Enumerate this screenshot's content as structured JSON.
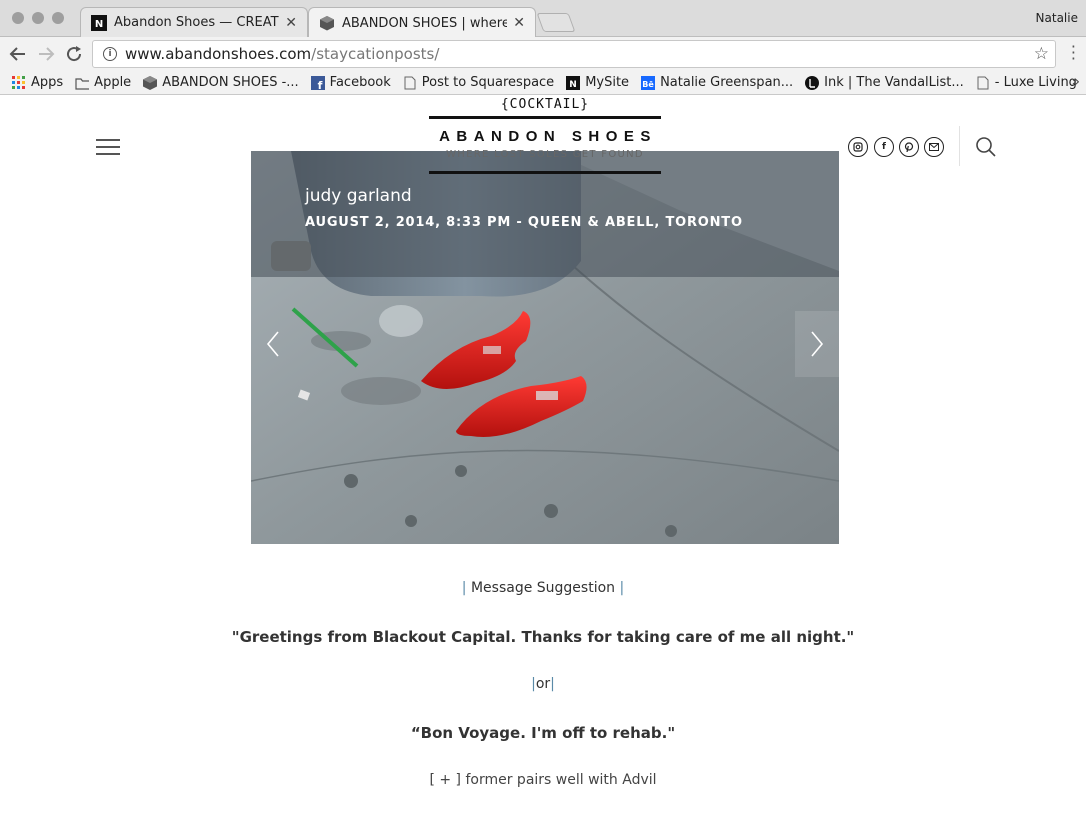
{
  "browser": {
    "tabs": [
      {
        "title": "Abandon Shoes — CREATIVE A",
        "favicon": "n-logo-icon",
        "active": false
      },
      {
        "title": "ABANDON SHOES | where lost",
        "favicon": "cube-icon",
        "active": true
      }
    ],
    "profile_name": "Natalie",
    "url_host": "www.abandonshoes.com",
    "url_path": "/staycationposts/",
    "bookmarks": [
      {
        "label": "Apps",
        "icon": "apps-grid-icon"
      },
      {
        "label": "Apple",
        "icon": "folder-icon"
      },
      {
        "label": "ABANDON SHOES -...",
        "icon": "cube-icon"
      },
      {
        "label": "Facebook",
        "icon": "facebook-icon"
      },
      {
        "label": "Post to Squarespace",
        "icon": "page-icon"
      },
      {
        "label": "MySite",
        "icon": "n-logo-icon"
      },
      {
        "label": "Natalie Greenspan...",
        "icon": "behance-icon"
      },
      {
        "label": "Ink | The VandalList...",
        "icon": "ink-icon"
      },
      {
        "label": "- Luxe Living",
        "icon": "page-icon"
      }
    ]
  },
  "site": {
    "cocktail": "{COCKTAIL}",
    "logo_title": "ABANDON SHOES",
    "logo_tagline": "WHERE LOST SOLES GET FOUND",
    "social_icons": [
      "instagram-icon",
      "facebook-icon",
      "pinterest-icon",
      "email-icon"
    ]
  },
  "slide": {
    "title": "judy garland",
    "meta": "AUGUST 2, 2014, 8:33 PM - QUEEN & ABELL, TORONTO"
  },
  "content": {
    "message_suggestion": "Message Suggestion",
    "quote_one": "\"Greetings from Blackout Capital. Thanks for taking care of me all night.\"",
    "or_text": "or",
    "quote_two": "“Bon Voyage. I'm off to rehab.\"",
    "footer_note": "[ + ] former pairs well with Advil"
  },
  "colors": {
    "accent_bar": "#5a8aa8",
    "shoe_red": "#e0201c"
  }
}
